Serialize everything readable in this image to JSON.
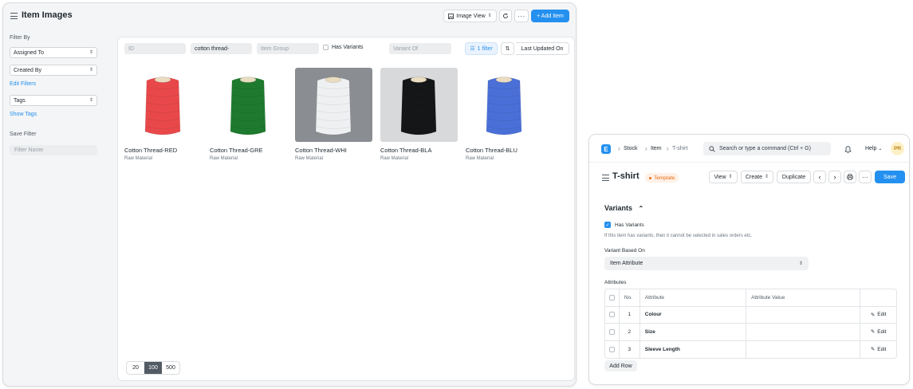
{
  "list_view": {
    "title": "Item Images",
    "toolbar": {
      "view_switcher": "Image View",
      "add_label": "+ Add Item"
    },
    "sidebar": {
      "filter_by": "Filter By",
      "selects": [
        "Assigned To",
        "Created By"
      ],
      "edit_filters": "Edit Filters",
      "tags": "Tags",
      "show_tags": "Show Tags",
      "save_filter": "Save Filter",
      "filter_name_placeholder": "Filter Name"
    },
    "filters": {
      "id_placeholder": "ID",
      "name_value": "cotton thread-",
      "item_group_placeholder": "Item Group",
      "has_variants": "Has Variants",
      "variant_of_placeholder": "Variant Of",
      "filter_count": "1 filter",
      "sort": "Last Updated On"
    },
    "cards": [
      {
        "title": "Cotton Thread-RED",
        "subtitle": "Raw Material",
        "color": "#e8484a",
        "bg": "#ffffff"
      },
      {
        "title": "Cotton Thread-GRE",
        "subtitle": "Raw Material",
        "color": "#1e7a2e",
        "bg": "#ffffff"
      },
      {
        "title": "Cotton Thread-WHI",
        "subtitle": "Raw Material",
        "color": "#eef0f2",
        "bg": "#8a8d91"
      },
      {
        "title": "Cotton Thread-BLA",
        "subtitle": "Raw Material",
        "color": "#151618",
        "bg": "#d8d9db"
      },
      {
        "title": "Cotton Thread-BLU",
        "subtitle": "Raw Material",
        "color": "#4a6fd6",
        "bg": "#ffffff"
      }
    ],
    "page_sizes": [
      "20",
      "100",
      "500"
    ],
    "active_page_size": "100"
  },
  "item_form": {
    "breadcrumbs": [
      "Stock",
      "Item",
      "T-shirt"
    ],
    "logo_letter": "E",
    "search_placeholder": "Search or type a command (Ctrl + G)",
    "help": "Help",
    "avatar_initials": "PR",
    "title": "T-shirt",
    "badge": "Template",
    "actions": {
      "view": "View",
      "create": "Create",
      "duplicate": "Duplicate",
      "save": "Save"
    },
    "section": "Variants",
    "has_variants_label": "Has Variants",
    "has_variants_checked": true,
    "has_variants_help": "If this item has variants, then it cannot be selected in sales orders etc.",
    "variant_based_on_label": "Variant Based On",
    "variant_based_on_value": "Item Attribute",
    "attributes_label": "Attributes",
    "table": {
      "headers": [
        "No.",
        "Attribute",
        "Attribute Value"
      ],
      "rows": [
        {
          "no": "1",
          "attribute": "Colour",
          "value": ""
        },
        {
          "no": "2",
          "attribute": "Size",
          "value": ""
        },
        {
          "no": "3",
          "attribute": "Sleeve Length",
          "value": ""
        }
      ],
      "edit_label": "Edit"
    },
    "add_row": "Add Row"
  }
}
